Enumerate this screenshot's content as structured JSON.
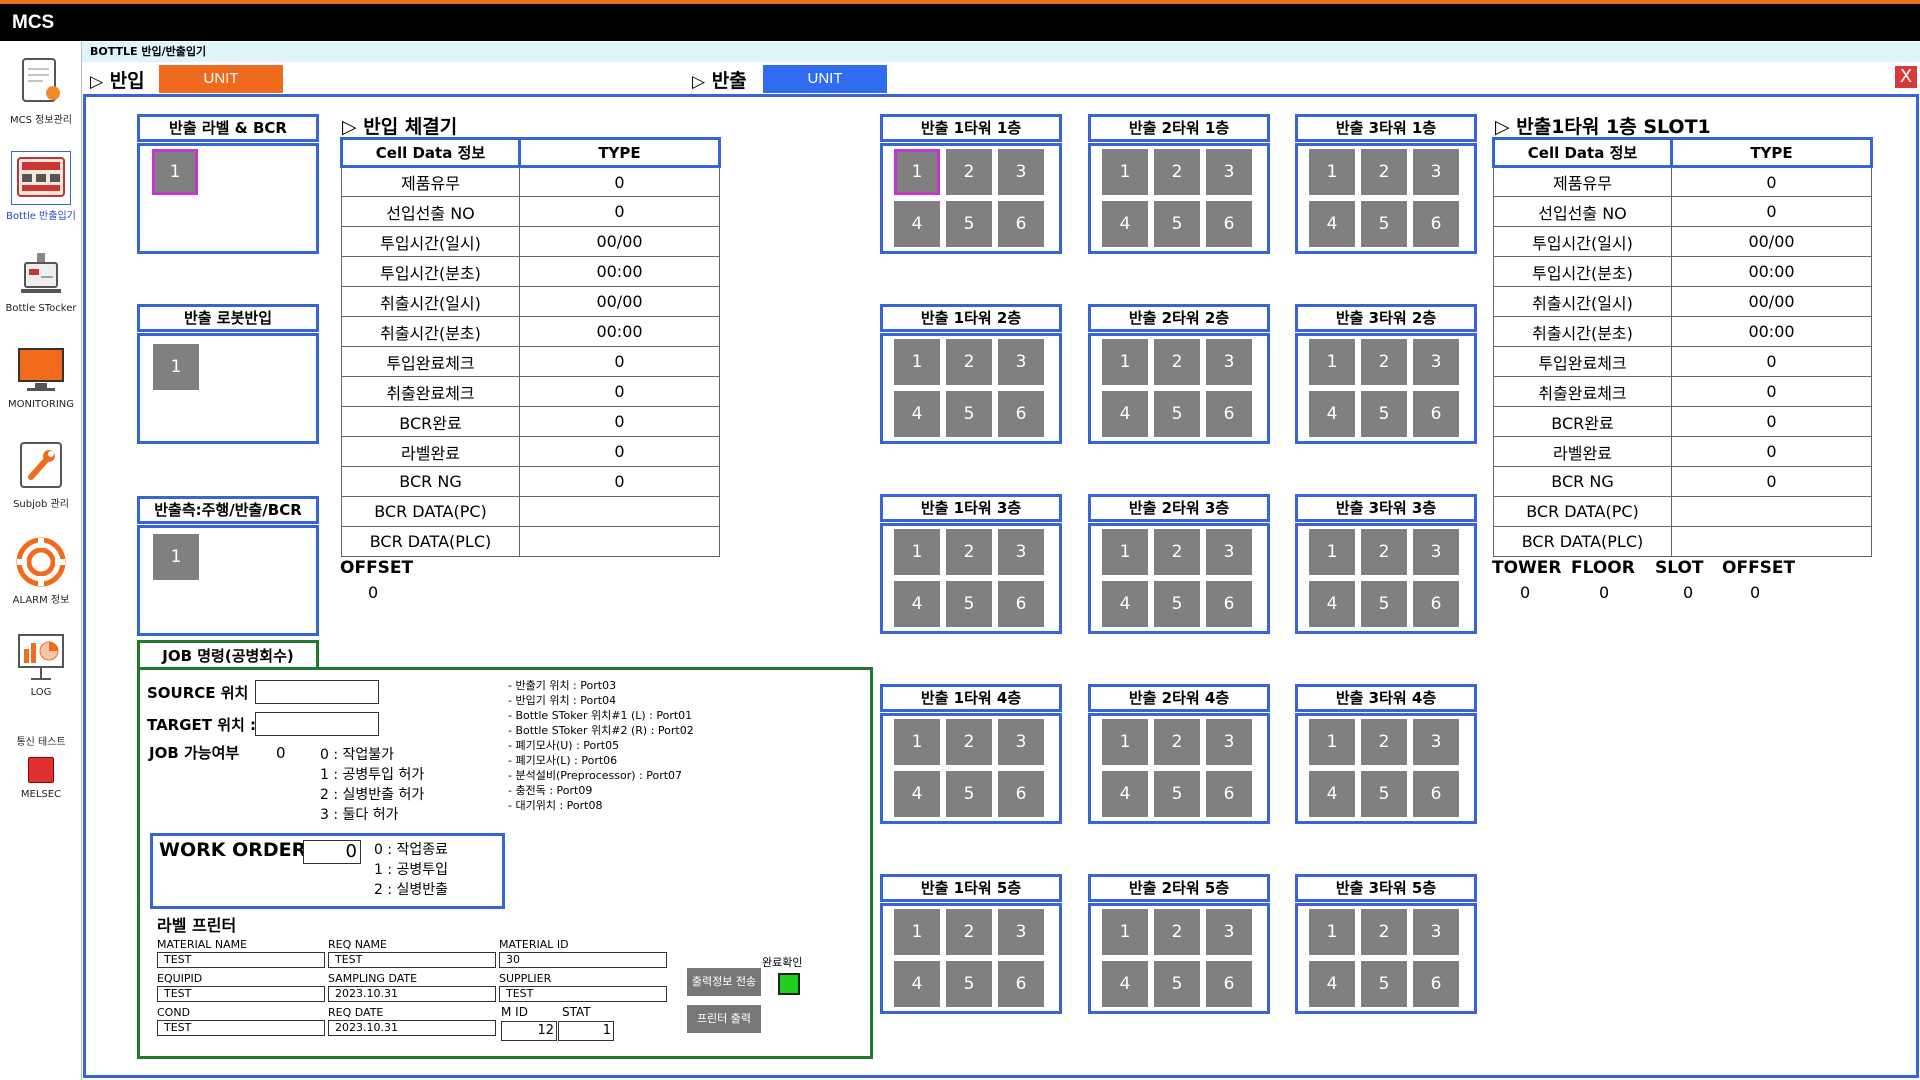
{
  "app": {
    "title": "MCS"
  },
  "breadcrumb": "BOTTLE 반입/반출입기",
  "tabs": {
    "in_label": "반입",
    "in_unit": "UNIT",
    "out_label": "반출",
    "out_unit": "UNIT",
    "in_color": "#f06a1d",
    "out_color": "#2f6cf0",
    "close": "X"
  },
  "sidebar": {
    "items": [
      {
        "label": "MCS 정보관리",
        "icon": "document-icon"
      },
      {
        "label": "Bottle 반출입기",
        "icon": "panel-board-icon"
      },
      {
        "label": "Bottle STocker",
        "icon": "stocker-icon"
      },
      {
        "label": "MONITORING",
        "icon": "monitor-icon"
      },
      {
        "label": "Subjob 관리",
        "icon": "wrench-icon"
      },
      {
        "label": "ALARM 정보",
        "icon": "alarm-icon"
      },
      {
        "label": "LOG",
        "icon": "chart-board-icon"
      }
    ],
    "comm_test": "통신 테스트",
    "melsec": "MELSEC",
    "melsec_color": "#e03030"
  },
  "left_panels": {
    "label_bcr": {
      "title": "반출 라벨 & BCR",
      "cells": [
        "1"
      ]
    },
    "robot_in": {
      "title": "반출 로봇반입",
      "cells": [
        "1"
      ]
    },
    "drive_bcr": {
      "title": "반출측:주행/반출/BCR",
      "cells": [
        "1"
      ]
    }
  },
  "in_clamp": {
    "title": "반입 체결기",
    "col1": "Cell Data 정보",
    "col2": "TYPE",
    "rows": [
      [
        "제품유무",
        "0"
      ],
      [
        "선입선출 NO",
        "0"
      ],
      [
        "투입시간(일시)",
        "00/00"
      ],
      [
        "투입시간(분초)",
        "00:00"
      ],
      [
        "취출시간(일시)",
        "00/00"
      ],
      [
        "취출시간(분초)",
        "00:00"
      ],
      [
        "투입완료체크",
        "0"
      ],
      [
        "취출완료체크",
        "0"
      ],
      [
        "BCR완료",
        "0"
      ],
      [
        "라벨완료",
        "0"
      ],
      [
        "BCR NG",
        "0"
      ],
      [
        "BCR DATA(PC)",
        ""
      ],
      [
        "BCR DATA(PLC)",
        ""
      ]
    ],
    "offset_label": "OFFSET",
    "offset_value": "0"
  },
  "towers": [
    [
      "반출 1타워 1층",
      "반출 2타워 1층",
      "반출 3타워 1층"
    ],
    [
      "반출 1타워 2층",
      "반출 2타워 2층",
      "반출 3타워 2층"
    ],
    [
      "반출 1타워 3층",
      "반출 2타워 3층",
      "반출 3타워 3층"
    ],
    [
      "반출 1타워 4층",
      "반출 2타워 4층",
      "반출 3타워 4층"
    ],
    [
      "반출 1타워 5층",
      "반출 2타워 5층",
      "반출 3타워 5층"
    ]
  ],
  "tower_cells": [
    "1",
    "2",
    "3",
    "4",
    "5",
    "6"
  ],
  "slot_detail": {
    "title": "반출1타워 1층  SLOT1",
    "col1": "Cell Data 정보",
    "col2": "TYPE",
    "rows": [
      [
        "제품유무",
        "0"
      ],
      [
        "선입선출 NO",
        "0"
      ],
      [
        "투입시간(일시)",
        "00/00"
      ],
      [
        "투입시간(분초)",
        "00:00"
      ],
      [
        "취출시간(일시)",
        "00/00"
      ],
      [
        "취출시간(분초)",
        "00:00"
      ],
      [
        "투입완료체크",
        "0"
      ],
      [
        "취출완료체크",
        "0"
      ],
      [
        "BCR완료",
        "0"
      ],
      [
        "라벨완료",
        "0"
      ],
      [
        "BCR NG",
        "0"
      ],
      [
        "BCR DATA(PC)",
        ""
      ],
      [
        "BCR DATA(PLC)",
        ""
      ]
    ],
    "footer_labels": [
      "TOWER",
      "FLOOR",
      "SLOT",
      "OFFSET"
    ],
    "footer_values": [
      "0",
      "0",
      "0",
      "0"
    ]
  },
  "job": {
    "title": "JOB 명령(공병회수)",
    "source_label": "SOURCE 위치 :",
    "source_value": "",
    "target_label": "TARGET 위치 :",
    "target_value": "",
    "possible_label": "JOB 가능여부",
    "possible_value": "0",
    "possible_options": [
      "0 : 작업불가",
      "1 : 공병투입 허가",
      "2 : 실병반출 허가",
      "3 : 둘다 허가"
    ],
    "ports": [
      "- 반출기 위치 : Port03",
      "- 반입기 위치 : Port04",
      "- Bottle SToker 위치#1 (L) : Port01",
      "- Bottle SToker 위치#2 (R) : Port02",
      "- 폐기모사(U) : Port05",
      "- 폐기모사(L) : Port06",
      "- 분석설비(Preprocessor) : Port07",
      "- 충전독 : Port09",
      "- 대기위치 : Port08"
    ],
    "work_order_label": "WORK ORDER :",
    "work_order_value": "0",
    "work_order_options": [
      "0 : 작업종료",
      "1 : 공병투입",
      "2 : 실병반출"
    ],
    "printer_title": "라벨 프린터",
    "fields": {
      "material_name_label": "MATERIAL NAME",
      "material_name": "TEST",
      "req_name_label": "REQ NAME",
      "req_name": "TEST",
      "material_id_label": "MATERIAL ID",
      "material_id": "30",
      "equipid_label": "EQUIPID",
      "equipid": "TEST",
      "sampling_date_label": "SAMPLING DATE",
      "sampling_date": "2023.10.31",
      "supplier_label": "SUPPLIER",
      "supplier": "TEST",
      "cond_label": "COND",
      "cond": "TEST",
      "req_date_label": "REQ DATE",
      "req_date": "2023.10.31",
      "mid_label": "M ID",
      "mid": "12",
      "stat_label": "STAT",
      "stat": "1"
    },
    "confirm_label": "완료확인",
    "confirm_color": "#1fd11f",
    "send_button": "출력정보 전송",
    "print_button": "프린터 출력"
  }
}
